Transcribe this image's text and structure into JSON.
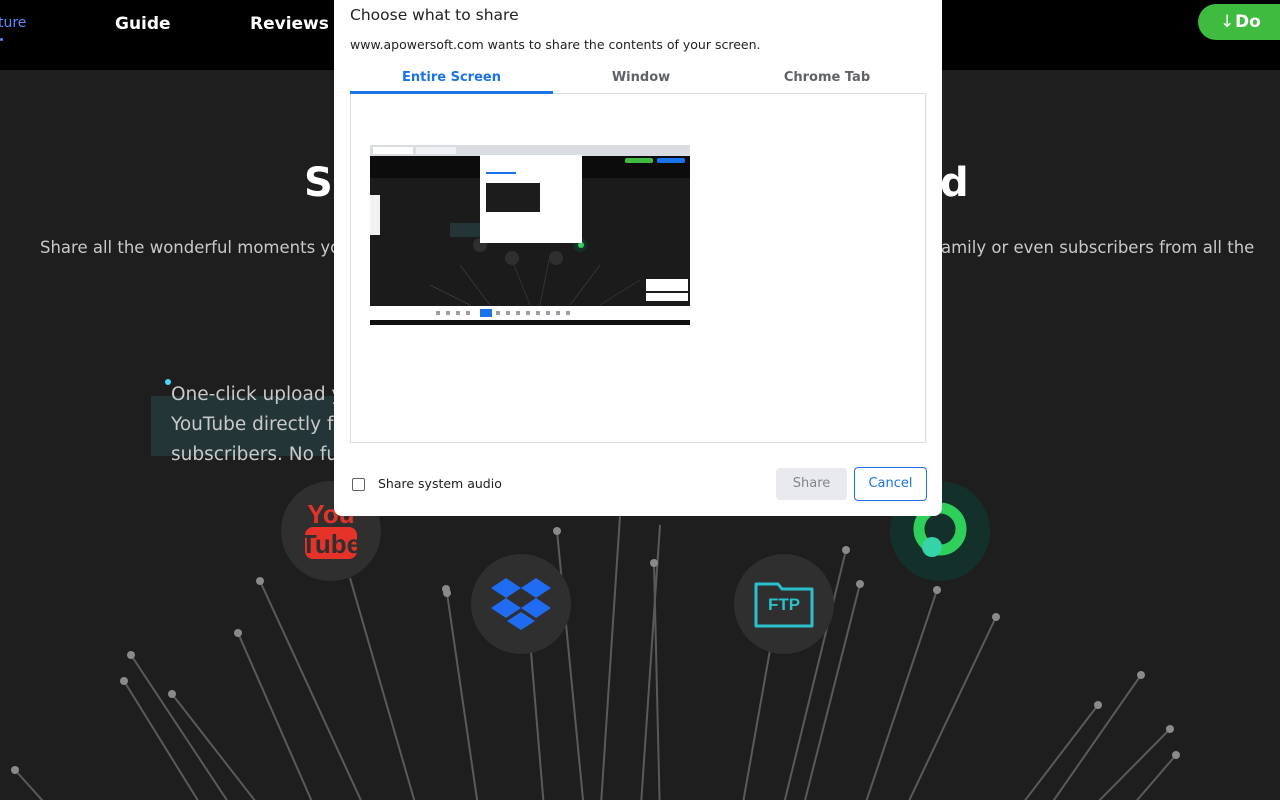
{
  "nav": {
    "feature_label": "ture",
    "guide_label": "Guide",
    "reviews_label": "Reviews",
    "download_label": "Do"
  },
  "background": {
    "headline_left": "S",
    "headline_right": "d",
    "description_left": "Share all the wonderful moments you",
    "description_right": "amily or even subscribers from all the",
    "feature_lines": [
      "One-click upload y",
      "YouTube directly fo",
      "subscribers. No fur"
    ],
    "icons": [
      "youtube-icon",
      "dropbox-icon",
      "ftp-icon",
      "green-app-icon"
    ],
    "ftp_label": "FTP"
  },
  "dialog": {
    "title": "Choose what to share",
    "subtitle": "www.apowersoft.com wants to share the contents of your screen.",
    "tabs": [
      "Entire Screen",
      "Window",
      "Chrome Tab"
    ],
    "selected_tab": "Entire Screen",
    "audio_label": "Share system audio",
    "audio_checked": false,
    "share_label": "Share",
    "cancel_label": "Cancel"
  },
  "colors": {
    "accent": "#1a73e8",
    "download_green": "#3fbc3f",
    "page_bg": "#1e1e1e",
    "nav_bg": "#000000"
  }
}
